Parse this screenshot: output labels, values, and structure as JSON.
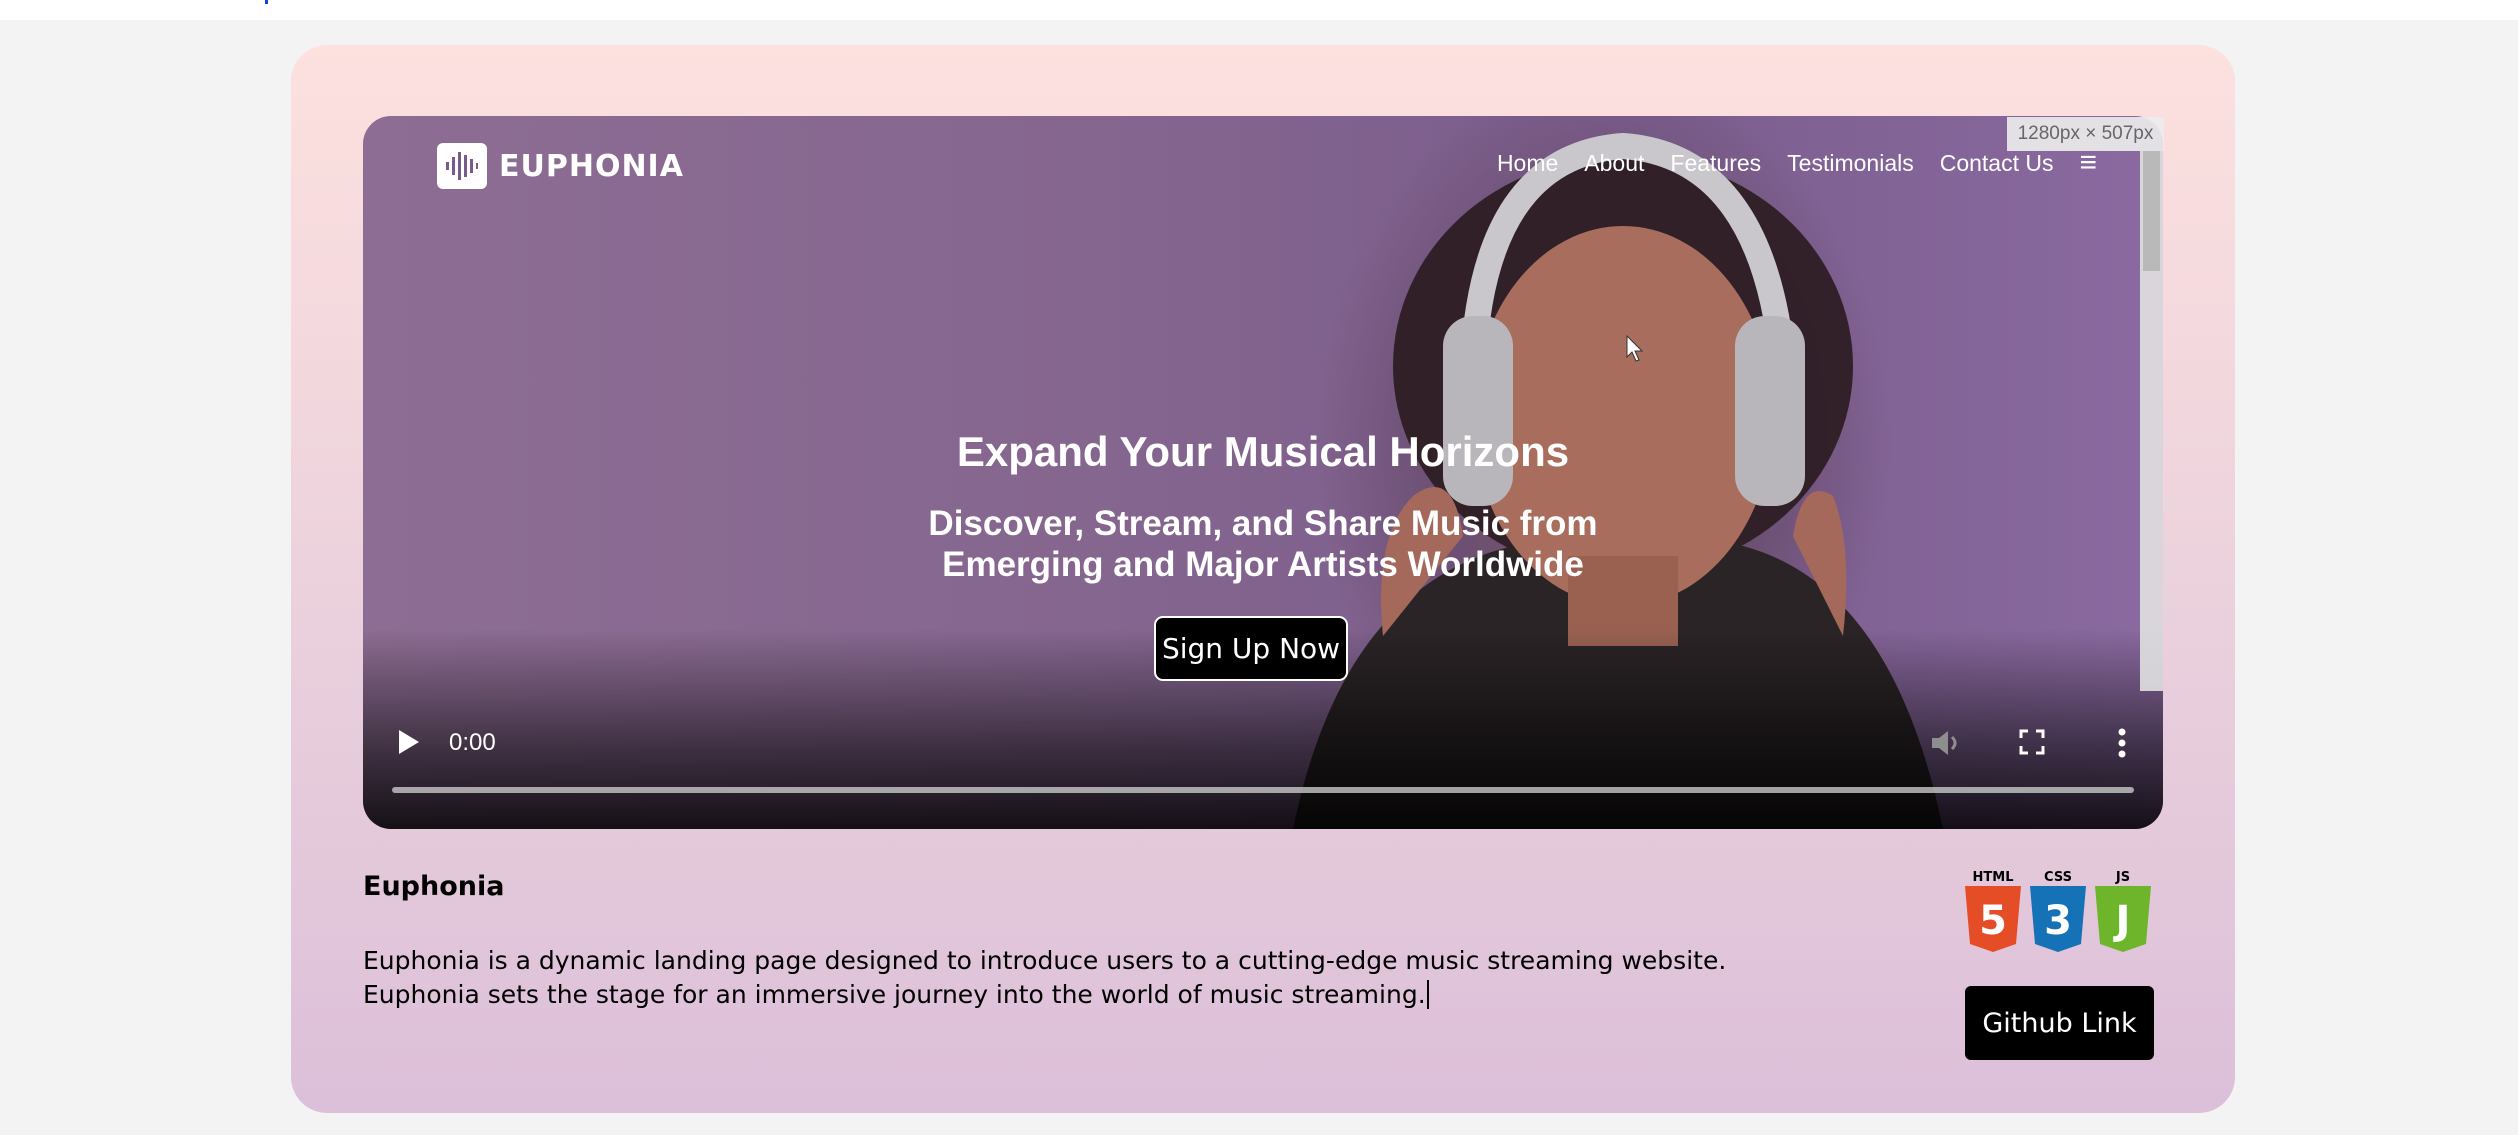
{
  "hero": {
    "brand": "EUPHONIA",
    "nav": [
      "Home",
      "About",
      "Features",
      "Testimonials",
      "Contact Us"
    ],
    "title": "Expand Your Musical Horizons",
    "subtitle_line1": "Discover, Stream, and Share Music from",
    "subtitle_line2": "Emerging and Major Artists Worldwide",
    "cta": "Sign Up Now",
    "size_tag": "1280px × 507px"
  },
  "player": {
    "time": "0:00",
    "progress": 0
  },
  "project": {
    "title": "Euphonia",
    "description": "Euphonia is a dynamic landing page designed to introduce users to a cutting-edge music streaming website. Euphonia sets the stage for an immersive journey into the world of music streaming.",
    "tech": [
      {
        "label": "HTML",
        "glyph": "5",
        "color": "#e44d26"
      },
      {
        "label": "CSS",
        "glyph": "3",
        "color": "#1572b6"
      },
      {
        "label": "JS",
        "glyph": "J",
        "color": "#6fb52c"
      }
    ],
    "github_label": "Github Link"
  }
}
